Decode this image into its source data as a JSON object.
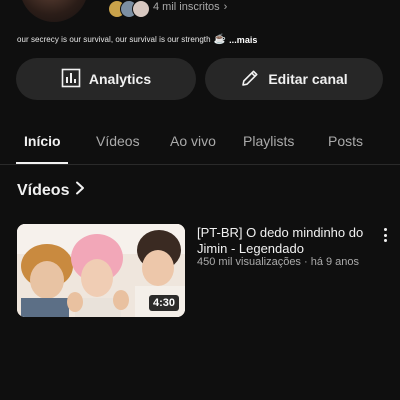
{
  "channel": {
    "subscribers": "4 mil inscritos",
    "description": "our secrecy is our survival, our survival is our strength",
    "description_emoji": "☕",
    "more_label": "...mais"
  },
  "actions": {
    "analytics_label": "Analytics",
    "edit_label": "Editar canal"
  },
  "tabs": [
    {
      "label": "Início",
      "active": true
    },
    {
      "label": "Vídeos",
      "active": false
    },
    {
      "label": "Ao vivo",
      "active": false
    },
    {
      "label": "Playlists",
      "active": false
    },
    {
      "label": "Posts",
      "active": false
    }
  ],
  "section": {
    "title": "Vídeos"
  },
  "video": {
    "title": "[PT-BR] O dedo mindinho do Jimin - Legendado",
    "meta": "450 mil visualizações · há 9 anos",
    "duration": "4:30"
  },
  "icons": {
    "analytics": "bar-chart-icon",
    "edit": "pencil-icon",
    "chevron": "chevron-right-icon",
    "more": "more-vert-icon"
  }
}
